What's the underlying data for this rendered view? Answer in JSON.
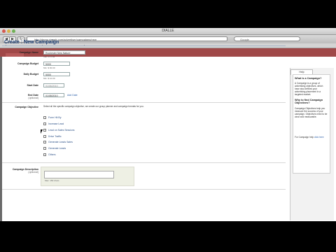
{
  "window": {
    "title": "DIALLE"
  },
  "toolbar": {
    "url": "http://demo.rtmadr.com/advertiser/campaigns/new",
    "search_placeholder": "Google"
  },
  "page": {
    "heading": "Create : New Campaign"
  },
  "form": {
    "campaign_name": {
      "label": "Campaign Name",
      "value": "Rochester New Nature",
      "hint": "Max 35 char"
    },
    "campaign_budget": {
      "label": "Campaign Budget",
      "value": "5000",
      "hint": "Min: $ 60.00"
    },
    "daily_budget": {
      "label": "Daily Budget",
      "value": "5000",
      "hint": "Min: $ 10.00"
    },
    "start_date": {
      "label": "Start Date",
      "value": "01/06/2010"
    },
    "end_date": {
      "label": "End Date",
      "sublabel": "(optional)",
      "value": "01/08/2010",
      "action": "Add Date"
    },
    "objective": {
      "label": "Campaign Objective",
      "intro": "Select all the specific campaign objective, we create our group planner and campaign formats for you.",
      "options": [
        "Form Hit By",
        "Increase Lead",
        "Lead on Sales Sessions",
        "Drive Traffic",
        "Generate Leads Sales",
        "Generate Leads",
        "Others"
      ]
    },
    "description": {
      "label": "Campaign Description",
      "sublabel": "(optional)",
      "hint": "Max: 150 chars"
    }
  },
  "sidebar": {
    "tab": "Help",
    "h1": "What is a Campaign?",
    "p1": "A Campaign is a group of advertising objectives, which have also defined your advertising placement in a targeted market.",
    "h2": "Why to find Campaign Objectives?",
    "p2": "Campaign Objectives help you measure the success of your campaign. Objectives need to be clear and measurable.",
    "foot": "For Campaign help",
    "foot_link": "click here"
  }
}
